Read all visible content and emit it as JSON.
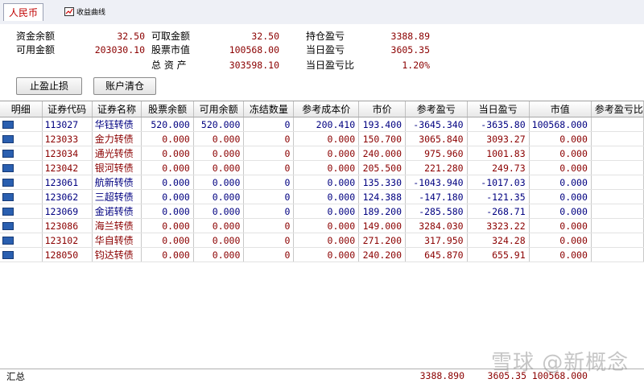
{
  "tabs": [
    {
      "label": "人民币",
      "active": true
    },
    {
      "label": "收益曲线",
      "icon": "chart-icon"
    }
  ],
  "summary": {
    "cash_balance_label": "资金余额",
    "cash_balance": "32.50",
    "withdrawable_label": "可取金额",
    "withdrawable": "32.50",
    "position_pnl_label": "持仓盈亏",
    "position_pnl": "3388.89",
    "available_label": "可用金额",
    "available": "203030.10",
    "stock_value_label": "股票市值",
    "stock_value": "100568.00",
    "today_pnl_label": "当日盈亏",
    "today_pnl": "3605.35",
    "total_assets_label": "总 资 产",
    "total_assets": "303598.10",
    "today_pnl_ratio_label": "当日盈亏比",
    "today_pnl_ratio": "1.20%"
  },
  "buttons": {
    "stop_loss": "止盈止损",
    "clear_account": "账户清仓"
  },
  "table": {
    "headers": [
      "明细",
      "证券代码",
      "证券名称",
      "股票余额",
      "可用余额",
      "冻结数量",
      "参考成本价",
      "市价",
      "参考盈亏",
      "当日盈亏",
      "市值",
      "参考盈亏比"
    ],
    "rows": [
      {
        "code": "113027",
        "name": "华钰转债",
        "balance": "520.000",
        "avail": "520.000",
        "frozen": "0",
        "cost": "200.410",
        "price": "193.400",
        "pnl": "-3645.340",
        "today": "-3635.80",
        "value": "100568.000",
        "tone": "blue"
      },
      {
        "code": "123033",
        "name": "金力转债",
        "balance": "0.000",
        "avail": "0.000",
        "frozen": "0",
        "cost": "0.000",
        "price": "150.700",
        "pnl": "3065.840",
        "today": "3093.27",
        "value": "0.000",
        "tone": "red"
      },
      {
        "code": "123034",
        "name": "通光转债",
        "balance": "0.000",
        "avail": "0.000",
        "frozen": "0",
        "cost": "0.000",
        "price": "240.000",
        "pnl": "975.960",
        "today": "1001.83",
        "value": "0.000",
        "tone": "red"
      },
      {
        "code": "123042",
        "name": "银河转债",
        "balance": "0.000",
        "avail": "0.000",
        "frozen": "0",
        "cost": "0.000",
        "price": "205.500",
        "pnl": "221.280",
        "today": "249.73",
        "value": "0.000",
        "tone": "red"
      },
      {
        "code": "123061",
        "name": "航新转债",
        "balance": "0.000",
        "avail": "0.000",
        "frozen": "0",
        "cost": "0.000",
        "price": "135.330",
        "pnl": "-1043.940",
        "today": "-1017.03",
        "value": "0.000",
        "tone": "blue"
      },
      {
        "code": "123062",
        "name": "三超转债",
        "balance": "0.000",
        "avail": "0.000",
        "frozen": "0",
        "cost": "0.000",
        "price": "124.388",
        "pnl": "-147.180",
        "today": "-121.35",
        "value": "0.000",
        "tone": "blue"
      },
      {
        "code": "123069",
        "name": "金诺转债",
        "balance": "0.000",
        "avail": "0.000",
        "frozen": "0",
        "cost": "0.000",
        "price": "189.200",
        "pnl": "-285.580",
        "today": "-268.71",
        "value": "0.000",
        "tone": "blue"
      },
      {
        "code": "123086",
        "name": "海兰转债",
        "balance": "0.000",
        "avail": "0.000",
        "frozen": "0",
        "cost": "0.000",
        "price": "149.000",
        "pnl": "3284.030",
        "today": "3323.22",
        "value": "0.000",
        "tone": "red"
      },
      {
        "code": "123102",
        "name": "华自转债",
        "balance": "0.000",
        "avail": "0.000",
        "frozen": "0",
        "cost": "0.000",
        "price": "271.200",
        "pnl": "317.950",
        "today": "324.28",
        "value": "0.000",
        "tone": "red"
      },
      {
        "code": "128050",
        "name": "钧达转债",
        "balance": "0.000",
        "avail": "0.000",
        "frozen": "0",
        "cost": "0.000",
        "price": "240.200",
        "pnl": "645.870",
        "today": "655.91",
        "value": "0.000",
        "tone": "red"
      }
    ]
  },
  "footer": {
    "label": "汇总",
    "pnl_total": "3388.890",
    "today_total": "3605.35",
    "value_total": "100568.000"
  },
  "watermark": "雪球 @新概念"
}
